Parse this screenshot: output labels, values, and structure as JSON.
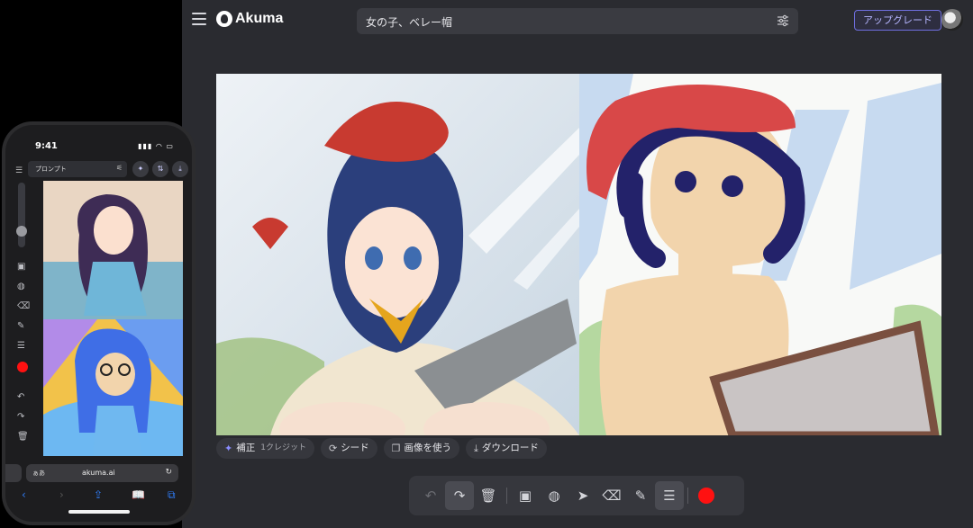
{
  "app": {
    "logo_text": "Akuma",
    "prompt_value": "女の子、ベレー帽",
    "upgrade_label": "アップグレード",
    "actions": {
      "enhance_label": "補正",
      "enhance_credits": "1クレジット",
      "seed_label": "シード",
      "use_image_label": "画像を使う",
      "download_label": "ダウンロード"
    },
    "brush_color": "#ff1111",
    "accent_color": "#6f6fe0"
  },
  "phone": {
    "time": "9:41",
    "prompt_label": "プロンプト",
    "url_aa": "ぁあ",
    "url_host": "akuma.ai"
  }
}
